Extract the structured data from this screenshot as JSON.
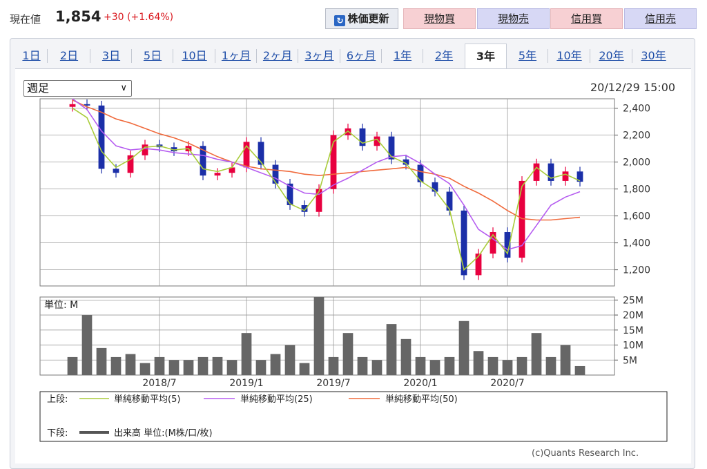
{
  "quote": {
    "label": "現在値",
    "price": "1,854",
    "change": "+30 (+1.64%)"
  },
  "actions": {
    "refresh": "株価更新",
    "spot_buy": "現物買",
    "spot_sell": "現物売",
    "margin_buy": "信用買",
    "margin_sell": "信用売"
  },
  "colors": {
    "up_candle": "#e8003f",
    "down_candle": "#1b2fa8",
    "ma5": "#a9cc3a",
    "ma25": "#b55cf0",
    "ma50": "#f06a3c",
    "volume": "#666666"
  },
  "range_tabs": [
    {
      "label": "1日",
      "active": false
    },
    {
      "label": "2日",
      "active": false
    },
    {
      "label": "3日",
      "active": false
    },
    {
      "label": "5日",
      "active": false
    },
    {
      "label": "10日",
      "active": false
    },
    {
      "label": "1ヶ月",
      "active": false
    },
    {
      "label": "2ヶ月",
      "active": false
    },
    {
      "label": "3ヶ月",
      "active": false
    },
    {
      "label": "6ヶ月",
      "active": false
    },
    {
      "label": "1年",
      "active": false
    },
    {
      "label": "2年",
      "active": false
    },
    {
      "label": "3年",
      "active": true
    },
    {
      "label": "5年",
      "active": false
    },
    {
      "label": "10年",
      "active": false
    },
    {
      "label": "20年",
      "active": false
    },
    {
      "label": "30年",
      "active": false
    }
  ],
  "period_select": {
    "value": "週足"
  },
  "timestamp": "20/12/29 15:00",
  "chart_data": [
    {
      "type": "candlestick",
      "frequency": "weekly",
      "y_ticks": [
        "2,400",
        "2,200",
        "2,000",
        "1,800",
        "1,600",
        "1,400",
        "1,200"
      ],
      "ylim": [
        1080,
        2470
      ],
      "x_ticks": [
        "2018/7",
        "2019/1",
        "2019/7",
        "2020/1",
        "2020/7"
      ],
      "x_tick_dates": [
        "2018-07",
        "2019-01",
        "2019-07",
        "2020-01",
        "2020-07"
      ],
      "xlim": [
        "2018-01",
        "2020-12"
      ],
      "grid": true,
      "close": [
        {
          "date": "2018-01",
          "close": 2430
        },
        {
          "date": "2018-02",
          "close": 2420
        },
        {
          "date": "2018-03",
          "close": 1950
        },
        {
          "date": "2018-04",
          "close": 1920
        },
        {
          "date": "2018-05",
          "close": 2050
        },
        {
          "date": "2018-06",
          "close": 2130
        },
        {
          "date": "2018-07",
          "close": 2110
        },
        {
          "date": "2018-08",
          "close": 2080
        },
        {
          "date": "2018-09",
          "close": 2120
        },
        {
          "date": "2018-10",
          "close": 1900
        },
        {
          "date": "2018-11",
          "close": 1920
        },
        {
          "date": "2018-12",
          "close": 1960
        },
        {
          "date": "2019-01",
          "close": 2150
        },
        {
          "date": "2019-02",
          "close": 1980
        },
        {
          "date": "2019-03",
          "close": 1840
        },
        {
          "date": "2019-04",
          "close": 1680
        },
        {
          "date": "2019-05",
          "close": 1630
        },
        {
          "date": "2019-06",
          "close": 1800
        },
        {
          "date": "2019-07",
          "close": 2200
        },
        {
          "date": "2019-08",
          "close": 2250
        },
        {
          "date": "2019-09",
          "close": 2120
        },
        {
          "date": "2019-10",
          "close": 2190
        },
        {
          "date": "2019-11",
          "close": 2020
        },
        {
          "date": "2019-12",
          "close": 1980
        },
        {
          "date": "2020-01",
          "close": 1850
        },
        {
          "date": "2020-02",
          "close": 1780
        },
        {
          "date": "2020-03",
          "close": 1640
        },
        {
          "date": "2020-04",
          "close": 1160
        },
        {
          "date": "2020-05",
          "close": 1320
        },
        {
          "date": "2020-06",
          "close": 1480
        },
        {
          "date": "2020-07",
          "close": 1290
        },
        {
          "date": "2020-08",
          "close": 1860
        },
        {
          "date": "2020-09",
          "close": 1990
        },
        {
          "date": "2020-10",
          "close": 1860
        },
        {
          "date": "2020-11",
          "close": 1930
        },
        {
          "date": "2020-12",
          "close": 1854
        }
      ],
      "ma5": [
        2400,
        2330,
        2080,
        1960,
        2020,
        2110,
        2120,
        2090,
        2100,
        1950,
        1930,
        1960,
        2120,
        2000,
        1850,
        1690,
        1640,
        1780,
        2150,
        2230,
        2140,
        2170,
        2040,
        1990,
        1860,
        1790,
        1650,
        1200,
        1300,
        1460,
        1320,
        1820,
        1960,
        1880,
        1910,
        1860
      ],
      "ma25": [
        2470,
        2390,
        2230,
        2120,
        2090,
        2100,
        2090,
        2070,
        2060,
        2050,
        2020,
        2000,
        1960,
        1920,
        1880,
        1820,
        1770,
        1760,
        1830,
        1880,
        1940,
        2000,
        2040,
        2050,
        1990,
        1910,
        1840,
        1680,
        1500,
        1430,
        1350,
        1380,
        1530,
        1680,
        1740,
        1780
      ],
      "ma50": [
        2460,
        2410,
        2370,
        2320,
        2290,
        2250,
        2210,
        2180,
        2140,
        2090,
        2040,
        2000,
        1970,
        1950,
        1940,
        1930,
        1910,
        1900,
        1910,
        1920,
        1930,
        1940,
        1950,
        1960,
        1930,
        1910,
        1880,
        1820,
        1770,
        1710,
        1640,
        1580,
        1570,
        1570,
        1580,
        1590
      ]
    },
    {
      "type": "bar",
      "title": "単位: M",
      "y_ticks": [
        "25M",
        "20M",
        "15M",
        "10M",
        "5M"
      ],
      "ylim": [
        0,
        26
      ],
      "x_ticks": [
        "2018/7",
        "2019/1",
        "2019/7",
        "2020/1",
        "2020/7"
      ],
      "values": [
        6,
        20,
        9,
        6,
        7,
        4,
        6,
        5,
        5,
        6,
        6,
        5,
        14,
        5,
        7,
        10,
        4,
        26,
        6,
        14,
        6,
        5,
        17,
        12,
        6,
        5,
        6,
        18,
        8,
        6,
        5,
        6,
        14,
        6,
        10,
        3
      ]
    }
  ],
  "legend": {
    "upper_label": "上段:",
    "lower_label": "下段:",
    "ma5": "単純移動平均(5)",
    "ma25": "単純移動平均(25)",
    "ma50": "単純移動平均(50)",
    "volume": "出来高 単位:(M株/口/枚)"
  },
  "copyright": "(c)Quants Research Inc."
}
